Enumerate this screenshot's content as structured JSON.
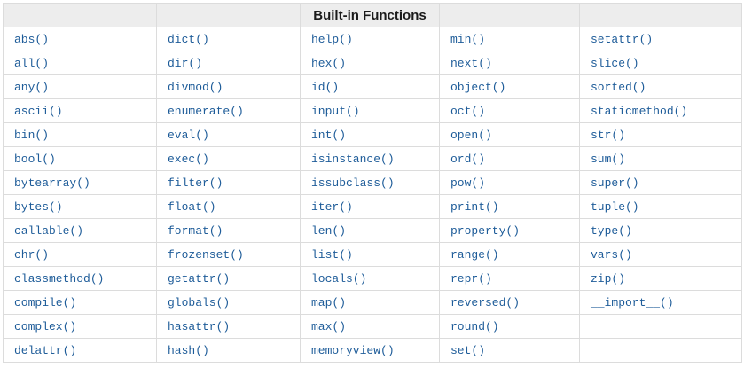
{
  "table": {
    "title": "Built-in Functions",
    "header_cells": [
      "",
      "",
      "Built-in Functions",
      "",
      ""
    ],
    "rows": [
      [
        "abs()",
        "dict()",
        "help()",
        "min()",
        "setattr()"
      ],
      [
        "all()",
        "dir()",
        "hex()",
        "next()",
        "slice()"
      ],
      [
        "any()",
        "divmod()",
        "id()",
        "object()",
        "sorted()"
      ],
      [
        "ascii()",
        "enumerate()",
        "input()",
        "oct()",
        "staticmethod()"
      ],
      [
        "bin()",
        "eval()",
        "int()",
        "open()",
        "str()"
      ],
      [
        "bool()",
        "exec()",
        "isinstance()",
        "ord()",
        "sum()"
      ],
      [
        "bytearray()",
        "filter()",
        "issubclass()",
        "pow()",
        "super()"
      ],
      [
        "bytes()",
        "float()",
        "iter()",
        "print()",
        "tuple()"
      ],
      [
        "callable()",
        "format()",
        "len()",
        "property()",
        "type()"
      ],
      [
        "chr()",
        "frozenset()",
        "list()",
        "range()",
        "vars()"
      ],
      [
        "classmethod()",
        "getattr()",
        "locals()",
        "repr()",
        "zip()"
      ],
      [
        "compile()",
        "globals()",
        "map()",
        "reversed()",
        "__import__()"
      ],
      [
        "complex()",
        "hasattr()",
        "max()",
        "round()",
        ""
      ],
      [
        "delattr()",
        "hash()",
        "memoryview()",
        "set()",
        ""
      ]
    ]
  },
  "colors": {
    "link": "#1e5c99",
    "header_bg": "#ededed",
    "border": "#dcdcdc",
    "header_text": "#1a1a1a"
  }
}
